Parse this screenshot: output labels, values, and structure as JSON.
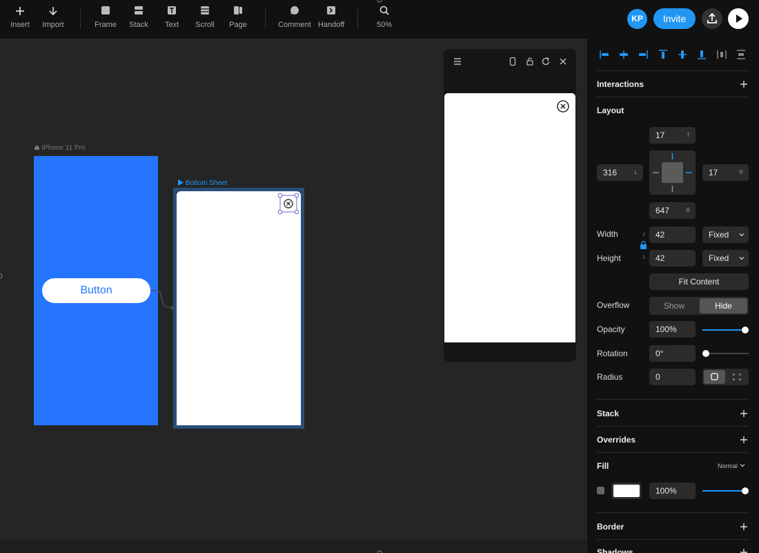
{
  "toolbar": {
    "tools": [
      {
        "label": "Insert",
        "icon": "plus-icon"
      },
      {
        "label": "Import",
        "icon": "arrow-down-icon"
      },
      {
        "label": "Frame",
        "icon": "frame-icon"
      },
      {
        "label": "Stack",
        "icon": "stack-icon"
      },
      {
        "label": "Text",
        "icon": "text-icon"
      },
      {
        "label": "Scroll",
        "icon": "scroll-icon"
      },
      {
        "label": "Page",
        "icon": "page-icon"
      },
      {
        "label": "Comment",
        "icon": "comment-icon"
      },
      {
        "label": "Handoff",
        "icon": "handoff-icon"
      },
      {
        "label": "50%",
        "icon": "zoom-icon"
      }
    ],
    "avatar_initials": "KP",
    "invite_label": "Invite",
    "share_icon": "upload-icon",
    "play_icon": "play-icon"
  },
  "canvas": {
    "iphone_label": "iPhone 11 Pro",
    "button_label": "Button",
    "sheet_label": "Bottom Sheet",
    "colors": {
      "frame_blue": "#2575ff",
      "selection": "#294f77",
      "accent": "#2196f3"
    }
  },
  "preview": {
    "icons": [
      "menu-icon",
      "device-icon",
      "unlock-icon",
      "refresh-icon",
      "close-icon"
    ]
  },
  "panel": {
    "interactions_label": "Interactions",
    "layout_label": "Layout",
    "layout": {
      "top": "17",
      "top_suffix": "T",
      "left": "316",
      "left_suffix": "L",
      "right": "17",
      "right_suffix": "R",
      "bottom": "647",
      "bottom_suffix": "B"
    },
    "width_label": "Width",
    "width_value": "42",
    "width_mode": "Fixed",
    "height_label": "Height",
    "height_value": "42",
    "height_mode": "Fixed",
    "fit_content_label": "Fit Content",
    "overflow_label": "Overflow",
    "overflow_show": "Show",
    "overflow_hide": "Hide",
    "opacity_label": "Opacity",
    "opacity_value": "100%",
    "opacity_level": 1.0,
    "rotation_label": "Rotation",
    "rotation_value": "0°",
    "rotation_level": 0.0,
    "radius_label": "Radius",
    "radius_value": "0",
    "stack_label": "Stack",
    "overrides_label": "Overrides",
    "fill_label": "Fill",
    "fill_blend": "Normal",
    "fill_color": "#ffffff",
    "fill_opacity": "100%",
    "fill_level": 1.0,
    "border_label": "Border",
    "shadows_label": "Shadows"
  }
}
